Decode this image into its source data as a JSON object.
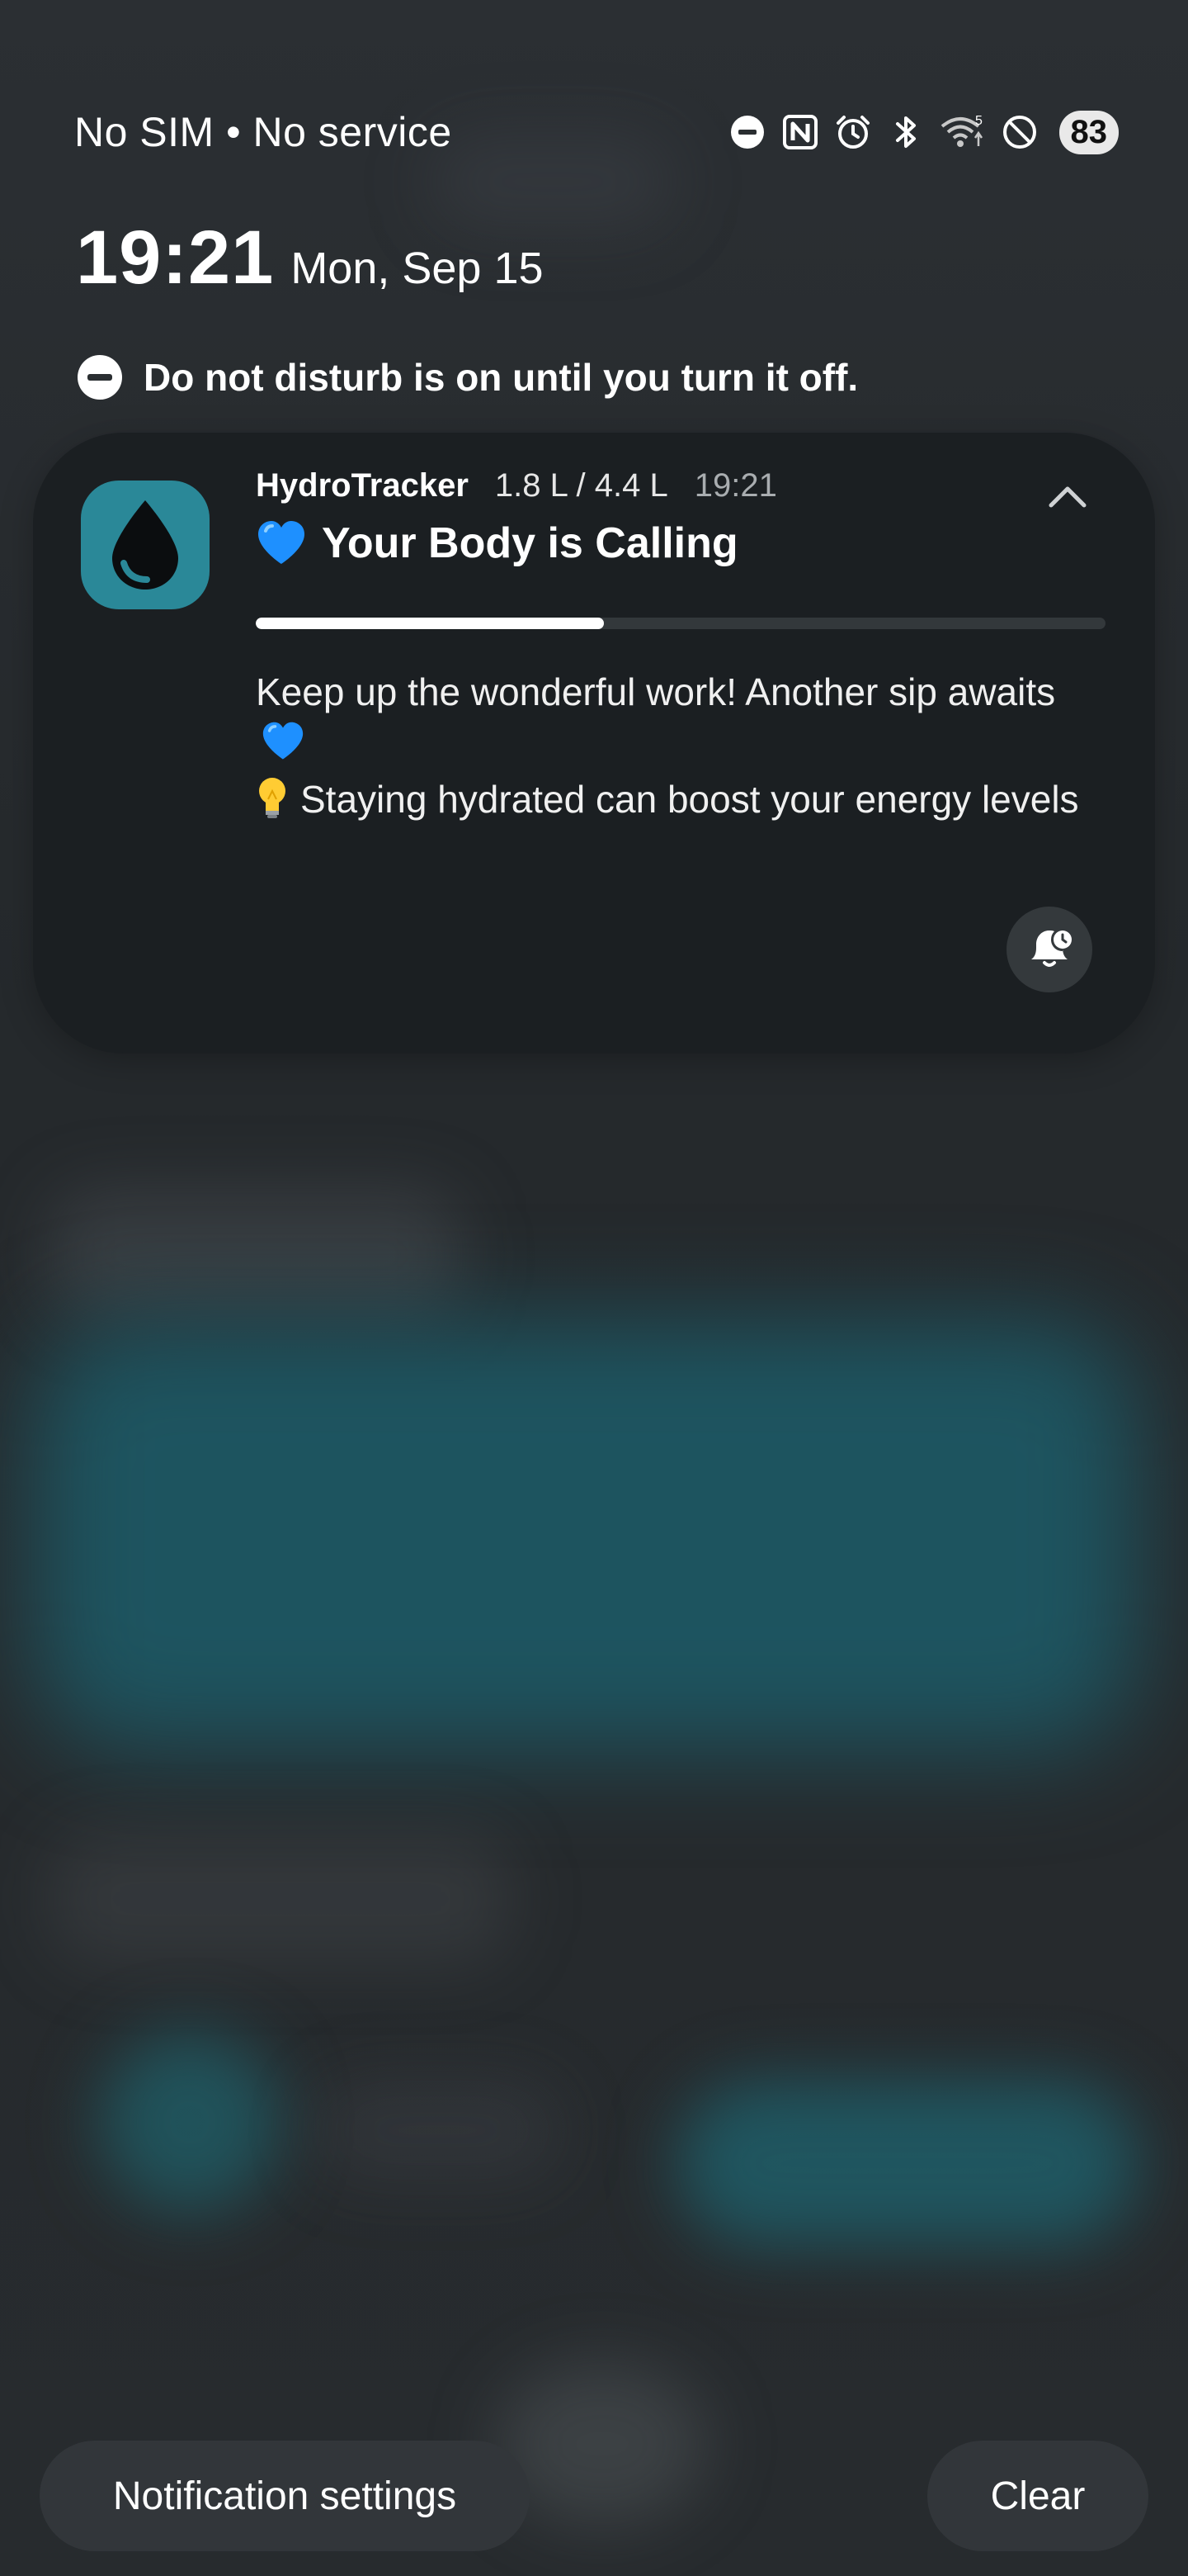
{
  "status_bar": {
    "carrier": "No SIM • No service",
    "icons": [
      "dnd-icon",
      "nfc-icon",
      "alarm-icon",
      "bluetooth-icon",
      "wifi-icon",
      "blocked-icon"
    ],
    "wifi_badge": "5",
    "battery": "83"
  },
  "lockscreen": {
    "time": "19:21",
    "date": "Mon, Sep 15"
  },
  "dnd_banner": {
    "icon": "dnd-icon",
    "text": "Do not disturb is on until you turn it off."
  },
  "notification": {
    "app_icon": "water-drop-icon",
    "app_name": "HydroTracker",
    "progress_text": "1.8 L / 4.4 L",
    "time": "19:21",
    "title_emoji": "blue-heart-icon",
    "title": "Your Body is Calling",
    "progress": 0.41,
    "body_line1": "Keep up the wonderful work! Another sip awaits",
    "body_line1_emoji": "blue-heart-icon",
    "body_line2_emoji": "light-bulb-icon",
    "body_line2": "Staying hydrated can boost your energy levels",
    "snooze_icon": "bell-clock-icon",
    "collapse_icon": "chevron-up-icon",
    "colors": {
      "accent": "#2a8898",
      "heart": "#1e90ff"
    }
  },
  "actions": {
    "settings_label": "Notification settings",
    "clear_label": "Clear"
  }
}
